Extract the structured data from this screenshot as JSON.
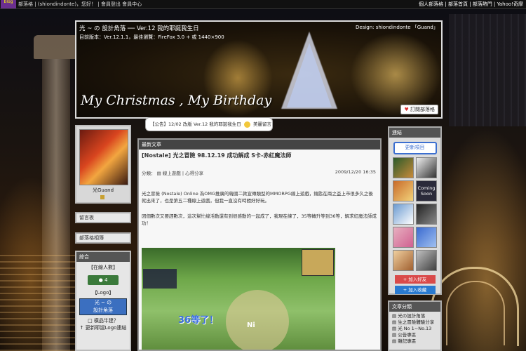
{
  "topbar": {
    "logo_text": "blog",
    "left_text": "部落格 | (shiondindonte)，您好！ | 會員登出 會員中心",
    "right_text": "個人部落格 | 部落首頁 | 部落熱門 | Yahoo!奇摩"
  },
  "banner": {
    "title": "光 ~ の  設計角落 ── Ver.12 我的耶誕我生日",
    "subtitle": "目前版本：Ver.12.1.1，最佳瀏覽：FireFox 3.0 + 或 1440×900",
    "tag": "Design: shiondindonte 「Guand」",
    "cursive": "My Christmas , My Birthday",
    "subscribe": "訂閱部落格"
  },
  "notice": {
    "text_before": "【公告】12/02 改版 Ver.12 我的耶誕我生日",
    "text_after": "美麗留言"
  },
  "left": {
    "avatar_name": "光Guand",
    "links": [
      "留言板",
      "部落格相簿"
    ],
    "comp_title": "綜合",
    "online_title": "【在線人數】",
    "online_count": "4",
    "logo_title": "【Logo】",
    "design_widget_top": "光 ~ の",
    "design_widget_bottom": "設計角落",
    "footer_1": "□ 橫品牛建？",
    "footer_2": "↑ 更新耶誕Logo連結"
  },
  "main": {
    "header": "最新文章",
    "post_title": "[Nostale] 光之冒險 98.12.19 成功解成 S卡-赤紅魔法師",
    "category": "分類： ▤ 線上遊戲 | 心得分享",
    "date": "2009/12/20 16:35",
    "body_1": "光之冒險 (Nostale) Online 為OMG推廣的韓國二款宣傳類型的MMORPG線上遊戲，鑰匙在兩之盃上市很多久之後就出來了，也是第五二種線上遊戲，但我一直沒有時間好好玩。",
    "body_2": "因個數次又要趕數次，這次幫忙線活動還有到很感動的一起成了，我現在練了，35等轉升等到36等，解求紅魔法師成功！",
    "game_text": "36等了！",
    "game_ni": "Ni"
  },
  "right": {
    "header": "連結",
    "update_label": "更新項目",
    "thumbs": [
      "",
      "",
      "",
      "Coming Soon",
      "",
      "",
      "",
      "",
      "",
      ""
    ],
    "btn_1": "+ 加入好友",
    "btn_2": "+ 加入收藏",
    "cats_header": "文章分類",
    "cats": [
      "▤ 光の設計角落",
      "▤ 生之冒險體驗分享",
      "▤ 光 No 1~No.13",
      "▤ 公告專區",
      "▤ 雜記專區"
    ]
  },
  "colors": {
    "accent": "#3c6fd0",
    "header_bg": "#555555",
    "online_green": "#3b7a3b"
  }
}
